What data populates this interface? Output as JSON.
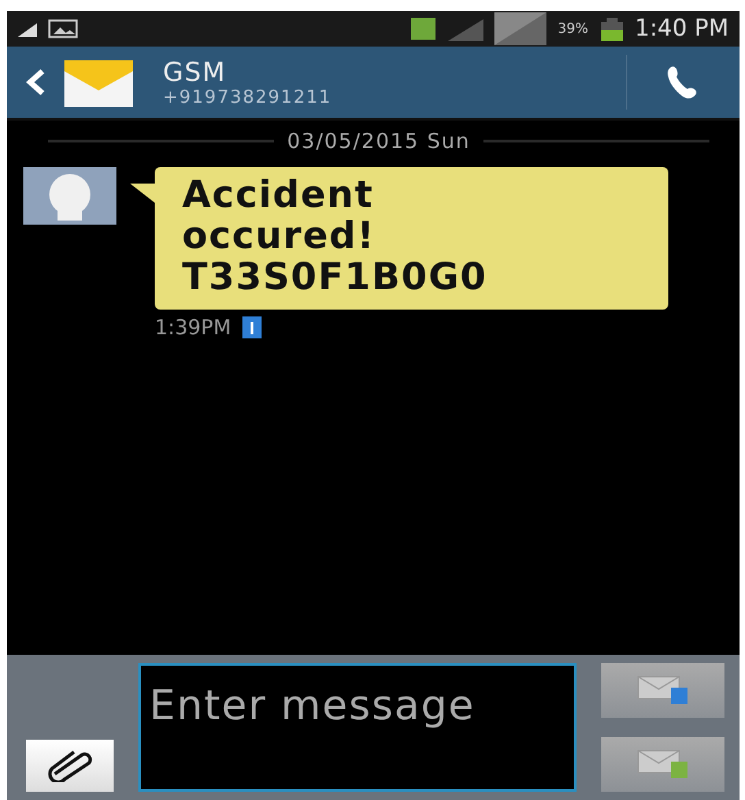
{
  "status_bar": {
    "battery": "39%",
    "time": "1:40 PM"
  },
  "header": {
    "title": "GSM",
    "number": "+919738291211"
  },
  "date_divider": "03/05/2015 Sun",
  "messages": [
    {
      "text": "Accident occured! T33S0F1B0G0",
      "time": "1:39PM"
    }
  ],
  "composer": {
    "placeholder": "Enter message"
  }
}
